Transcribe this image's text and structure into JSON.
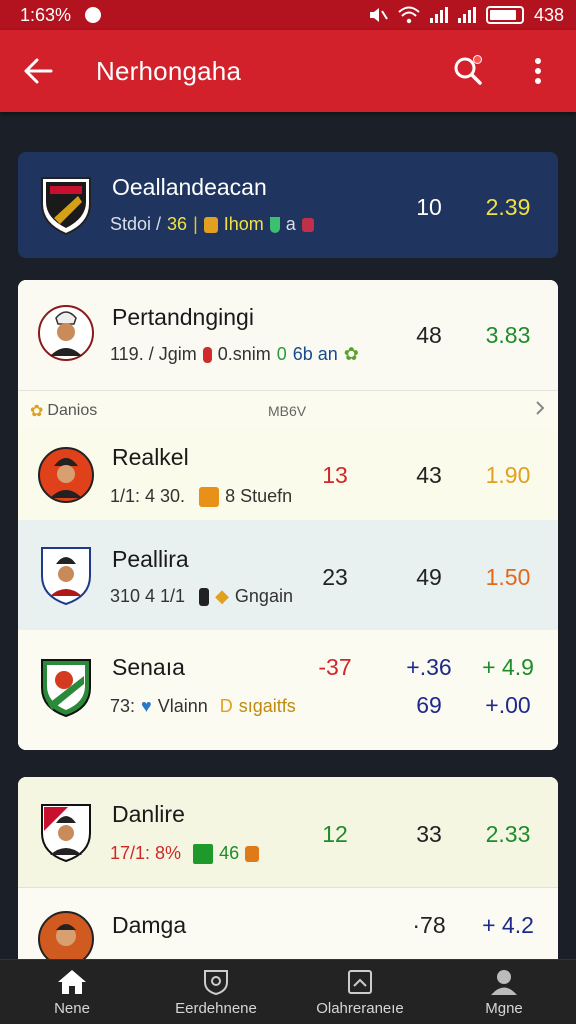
{
  "status": {
    "time": "1:63%",
    "battery": "438"
  },
  "appbar": {
    "title": "Nerhongaha"
  },
  "featured": {
    "team": "Oeallandeacan",
    "meta_a": "Stdoi /",
    "meta_b": "36",
    "meta_c": "Ihom",
    "meta_d": "a",
    "score": "10",
    "odds": "2.39"
  },
  "group1": [
    {
      "team": "Pertandngingi",
      "meta_a": "119. / Jgim",
      "meta_b": "0.snim",
      "meta_c": "0",
      "meta_d": "6b an",
      "c2": "48",
      "c3": "3.83"
    }
  ],
  "section": {
    "title": "Danios",
    "mid": "MB6V"
  },
  "group1b": [
    {
      "team": "Realkel",
      "meta_a": "1/1: 4 30.",
      "meta_b": "8 Stuefn",
      "c1": "13",
      "c2": "43",
      "c3": "1.90"
    },
    {
      "team": "Peallira",
      "meta_a": "310 4 1/1",
      "meta_b": "Gngain",
      "c1": "23",
      "c2": "49",
      "c3": "1.50"
    },
    {
      "team": "Senaıa",
      "meta_a": "73:",
      "meta_b": "Vlainn",
      "meta_c": "sıgaitfs",
      "c1": "-37",
      "c2": "+.36",
      "c2b": "69",
      "c3": "+ 4.9",
      "c3b": "+.00"
    }
  ],
  "group2": [
    {
      "team": "Danlire",
      "meta_a": "17/1: 8%",
      "meta_b": "46",
      "c1": "12",
      "c2": "33",
      "c3": "2.33"
    },
    {
      "team": "Damga",
      "c2": "·78",
      "c3": "+ 4.2"
    }
  ],
  "nav": [
    {
      "label": "Nene"
    },
    {
      "label": "Eerdehnene"
    },
    {
      "label": "Olahreraneıe"
    },
    {
      "label": "Mgne"
    }
  ]
}
